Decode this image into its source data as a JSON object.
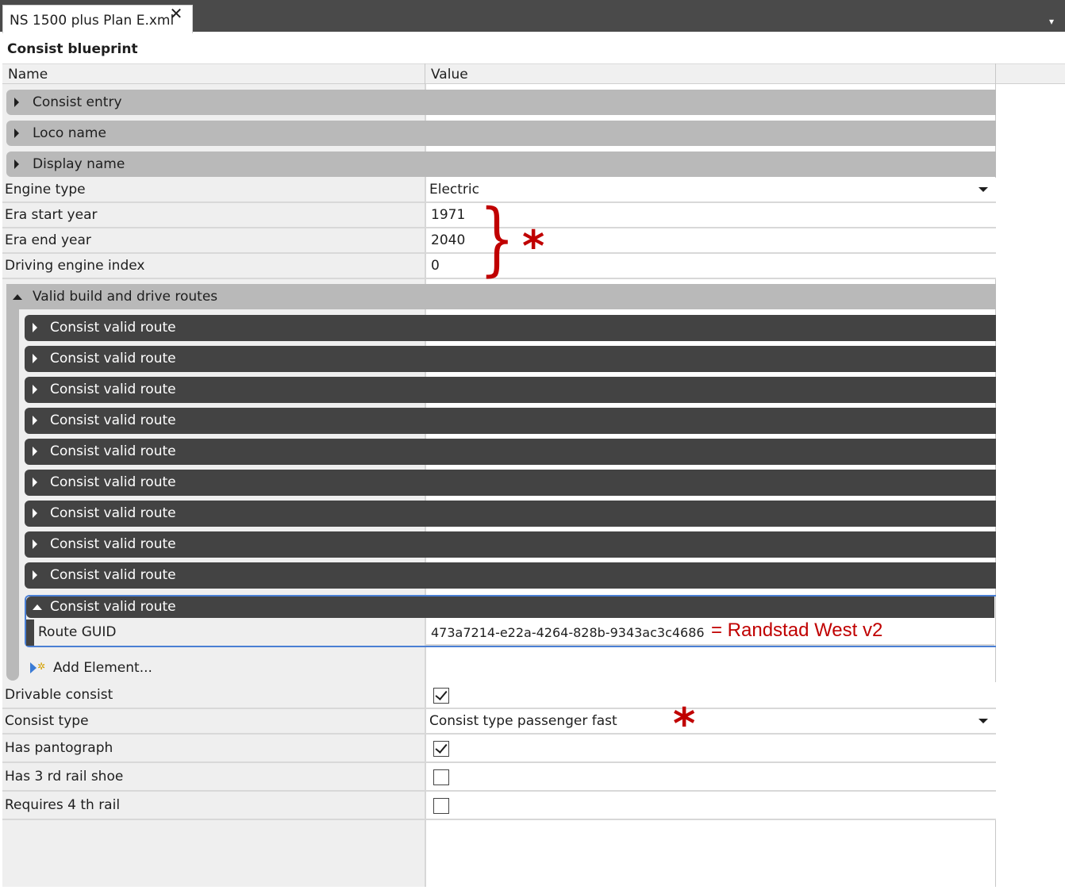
{
  "tab": {
    "title": "NS 1500 plus Plan E.xml",
    "close_glyph": "✕",
    "overflow_glyph": "▾"
  },
  "document": {
    "title": "Consist blueprint"
  },
  "grid": {
    "columns": {
      "name": "Name",
      "value": "Value"
    },
    "collapsed_sections": [
      "Consist entry",
      "Loco name",
      "Display name"
    ],
    "rows_top": [
      {
        "name": "Engine type",
        "value": "Electric",
        "kind": "dropdown"
      },
      {
        "name": "Era start year",
        "value": "1971",
        "kind": "text"
      },
      {
        "name": "Era end year",
        "value": "2040",
        "kind": "text"
      },
      {
        "name": "Driving engine index",
        "value": "0",
        "kind": "text"
      }
    ],
    "routes_group": {
      "label": "Valid build and drive routes",
      "collapsed_item_label": "Consist valid route",
      "collapsed_items": [
        "Consist valid route",
        "Consist valid route",
        "Consist valid route",
        "Consist valid route",
        "Consist valid route",
        "Consist valid route",
        "Consist valid route",
        "Consist valid route",
        "Consist valid route"
      ],
      "expanded_item": {
        "label": "Consist valid route",
        "field_name": "Route GUID",
        "field_value": "473a7214-e22a-4264-828b-9343ac3c4686"
      },
      "add_element_label": "Add Element..."
    },
    "rows_bottom": [
      {
        "name": "Drivable consist",
        "kind": "checkbox",
        "checked": true
      },
      {
        "name": "Consist type",
        "value": "Consist type passenger fast",
        "kind": "dropdown"
      },
      {
        "name": "Has pantograph",
        "kind": "checkbox",
        "checked": true
      },
      {
        "name": "Has 3 rd rail shoe",
        "kind": "checkbox",
        "checked": false
      },
      {
        "name": "Requires 4 th rail",
        "kind": "checkbox",
        "checked": false
      }
    ]
  },
  "annotations": {
    "brace": "}",
    "star": "*",
    "route_note": "= Randstad West v2",
    "color": "#c00000"
  }
}
